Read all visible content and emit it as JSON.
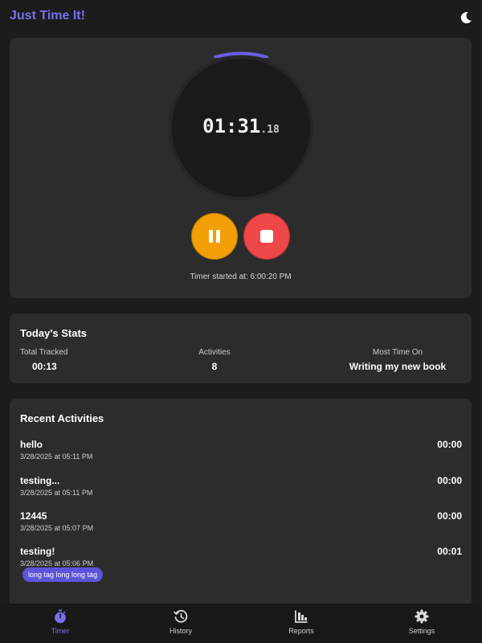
{
  "header": {
    "title": "Just Time It!",
    "theme_icon": "moon-icon"
  },
  "timer": {
    "time_main": "01:31",
    "time_ms": ".18",
    "started_at": "Timer started at: 6:00:20 PM",
    "pause_icon": "pause-icon",
    "stop_icon": "stop-icon",
    "colors": {
      "pause": "#f29f05",
      "stop": "#ee4747",
      "accent": "#7b6ff0"
    }
  },
  "stats": {
    "title": "Today's Stats",
    "total_tracked_label": "Total Tracked",
    "total_tracked_value": "00:13",
    "activities_label": "Activities",
    "activities_value": "8",
    "most_time_label": "Most Time On",
    "most_time_value": "Writing my new book"
  },
  "recent": {
    "title": "Recent Activities",
    "items": [
      {
        "name": "hello",
        "date": "3/28/2025 at 05:11 PM",
        "duration": "00:00"
      },
      {
        "name": "testing...",
        "date": "3/28/2025 at 05:11 PM",
        "duration": "00:00"
      },
      {
        "name": "12445",
        "date": "3/28/2025 at 05:07 PM",
        "duration": "00:00"
      },
      {
        "name": "testing!",
        "date": "3/28/2025 at 05:06 PM",
        "duration": "00:01",
        "tag": "long tag long long tag"
      }
    ]
  },
  "nav": {
    "items": [
      {
        "label": "Timer",
        "icon": "stopwatch-icon",
        "active": true
      },
      {
        "label": "History",
        "icon": "history-icon",
        "active": false
      },
      {
        "label": "Reports",
        "icon": "reports-icon",
        "active": false
      },
      {
        "label": "Settings",
        "icon": "gear-icon",
        "active": false
      }
    ]
  }
}
